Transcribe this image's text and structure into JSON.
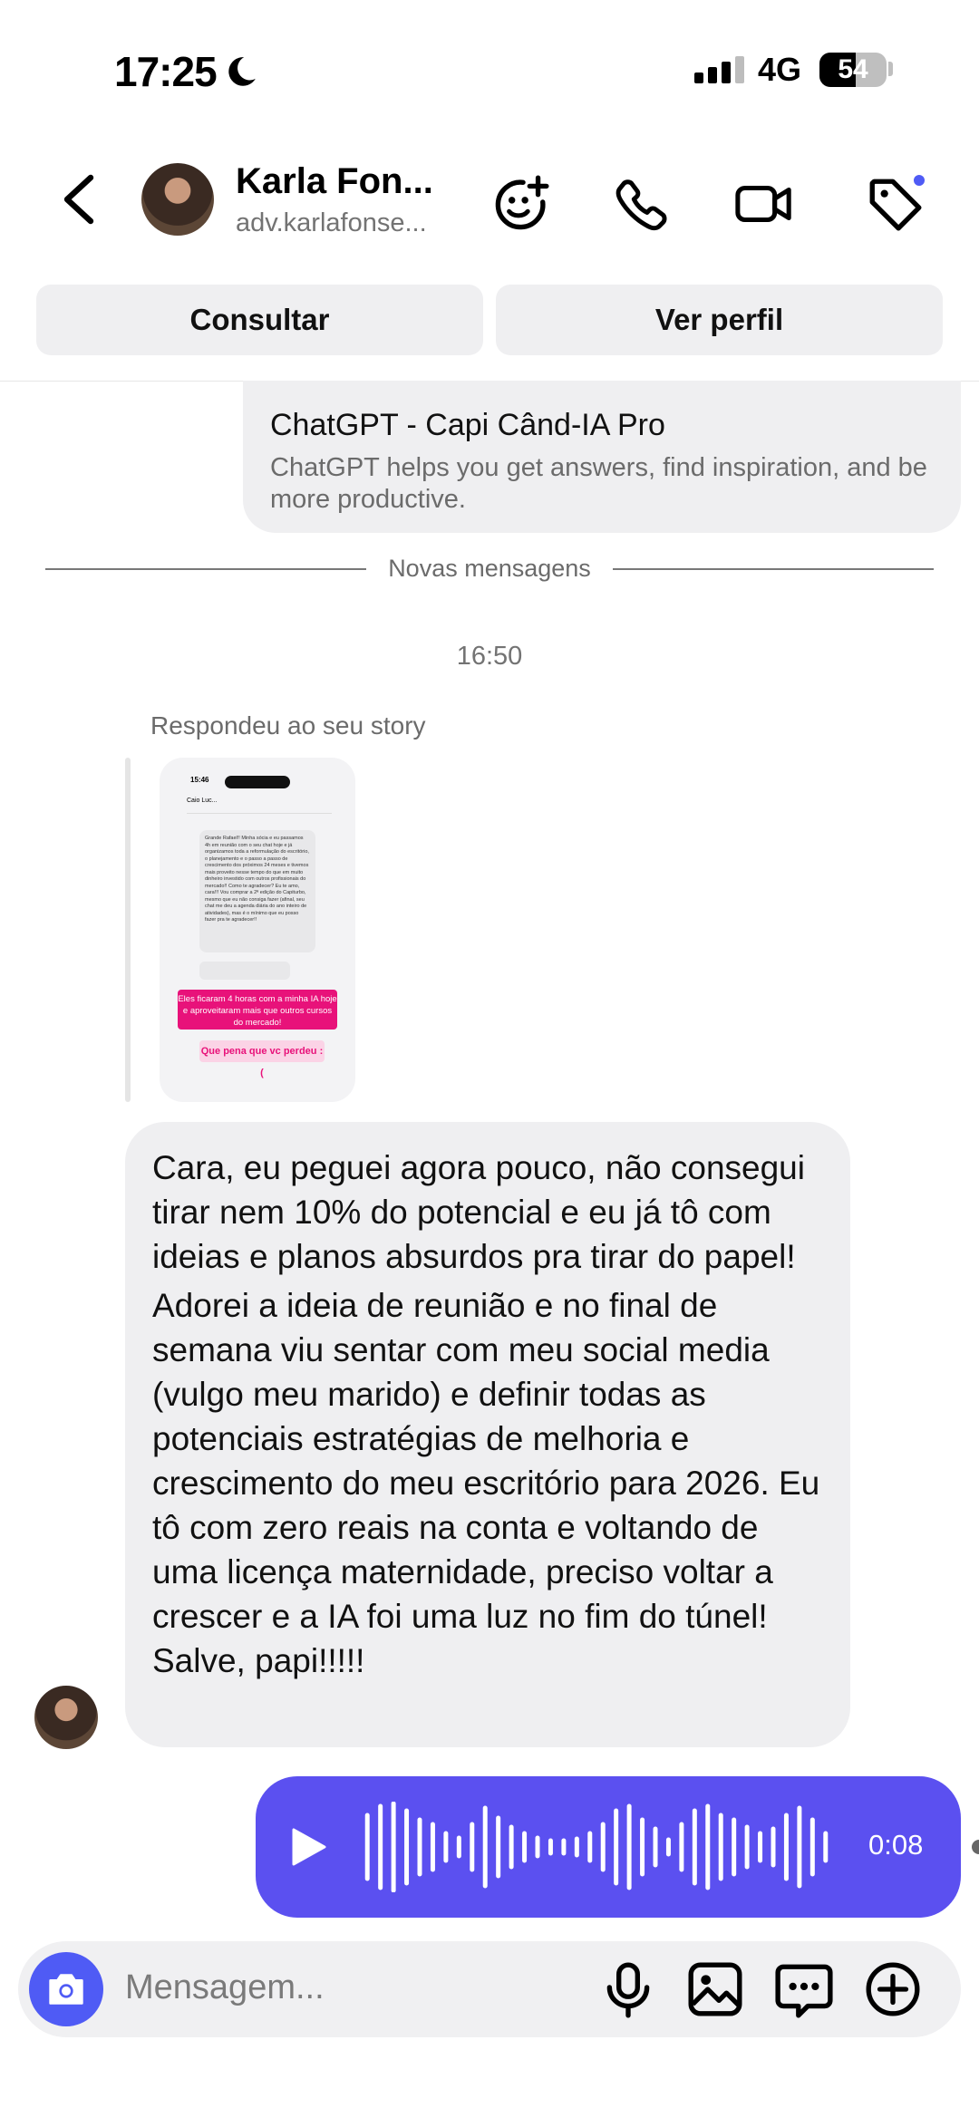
{
  "status_bar": {
    "time": "17:25",
    "network": "4G",
    "battery": "54"
  },
  "header": {
    "name": "Karla Fon...",
    "username": "adv.karlafonse..."
  },
  "actions": {
    "consult_label": "Consultar",
    "profile_label": "Ver perfil"
  },
  "link_preview": {
    "title": "ChatGPT - Capi Când-IA Pro",
    "description": "ChatGPT helps you get answers, find inspiration, and be more productive."
  },
  "divider": {
    "text": "Novas mensagens"
  },
  "timestamp": "16:50",
  "story_reply": {
    "label": "Respondeu ao seu story",
    "thumb_time": "15:46",
    "thumb_name": "Caio Luc...",
    "thumb_message": "Grande Rafael!! Minha sócia e eu passamos 4h em reunião com o seu chat hoje e já organizamos toda a reformulação do escritório, o planejamento e o passo a passo de crescimento dos próximos 24 meses e tivemos mais proveito nesse tempo do que em muito dinheiro investido com outros profissionais do mercado!! Como te agradecer? Eu te amo, cara!!! Vou comprar a 2ª edição do Capiturbo, mesmo que eu não consiga fazer (afinal, seu chat me deu a agenda diária do ano inteiro de atividades), mas é o mínimo que eu posso fazer pra te agradecer!!",
    "thumb_highlight": "Eles ficaram 4 horas com a minha IA hoje e aproveitaram mais que outros cursos do mercado!",
    "thumb_question": "Que pena que vc perdeu :("
  },
  "received_message": {
    "paragraph1": "Cara, eu peguei agora pouco, não consegui tirar nem 10% do potencial e eu já tô com ideias e planos absurdos pra tirar do papel!",
    "paragraph2": "Adorei a ideia de reunião e no final de semana viu sentar com meu social media (vulgo meu marido) e definir todas as potenciais estratégias de melhoria e crescimento do meu escritório para 2026. Eu tô com zero reais na conta e voltando de uma licença maternidade, preciso voltar a crescer e a IA foi uma luz no fim do túnel! Salve, papi!!!!!"
  },
  "voice_message": {
    "duration": "0:08",
    "color": "#5b50f0"
  },
  "composer": {
    "placeholder": "Mensagem..."
  },
  "colors": {
    "accent": "#4f5bf5",
    "bubble_in": "#efeff1"
  }
}
